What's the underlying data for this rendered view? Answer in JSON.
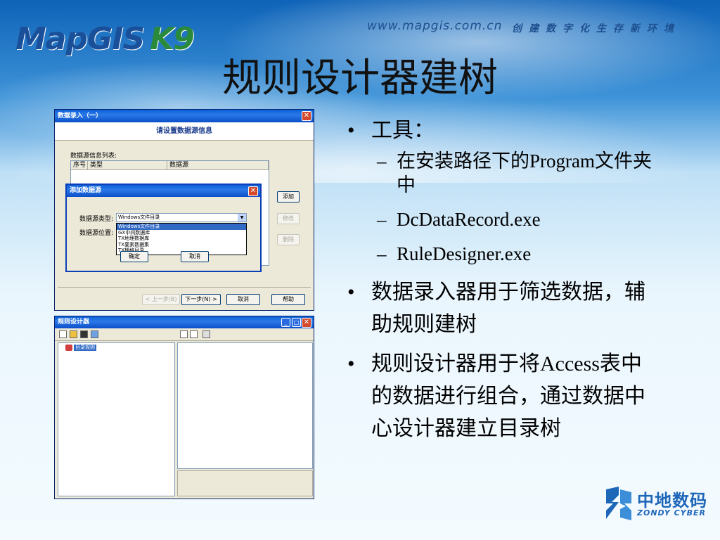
{
  "header": {
    "logo_main": "MapGIS",
    "logo_suffix": "K9",
    "url": "www.mapgis.com.cn",
    "motto": "创建数字化生存新环境"
  },
  "slide": {
    "title": "规则设计器建树",
    "bullets": [
      {
        "text": "工具：",
        "sub": [
          "在安装路径下的Program文件夹中",
          "DcDataRecord.exe",
          "RuleDesigner.exe"
        ]
      },
      {
        "text": "数据录入器用于筛选数据，辅助规则建树"
      },
      {
        "text": "规则设计器用于将Access表中的数据进行组合，通过数据中心设计器建立目录树"
      }
    ]
  },
  "screenshot1": {
    "title": "数据录入（一）",
    "header": "请设置数据源信息",
    "list_label": "数据源信息列表:",
    "columns": [
      "序号",
      "类型",
      "数据源"
    ],
    "buttons": {
      "add": "添加",
      "edit": "修改",
      "delete": "删除",
      "prev": "< 上一步(B)",
      "next": "下一步(N) >",
      "cancel": "取消",
      "help": "帮助"
    }
  },
  "dialog": {
    "title": "添加数据源",
    "type_label": "数据源类型:",
    "location_label": "数据源位置:",
    "selected": "Windows文件目录",
    "options": [
      "Windows文件目录",
      "GX中间数据库",
      "TX地理数据库",
      "TX要素数据集",
      "TX栅格目录"
    ],
    "ok": "确定",
    "cancel": "取消"
  },
  "screenshot2": {
    "title": "规则设计器",
    "tree_root": "目录规则"
  },
  "brand": {
    "cn": "中地数码",
    "en": "ZONDY CYBER"
  },
  "colors": {
    "xp_title": "#0a5fd8",
    "brand": "#1e66b8",
    "selection": "#316ac5"
  }
}
